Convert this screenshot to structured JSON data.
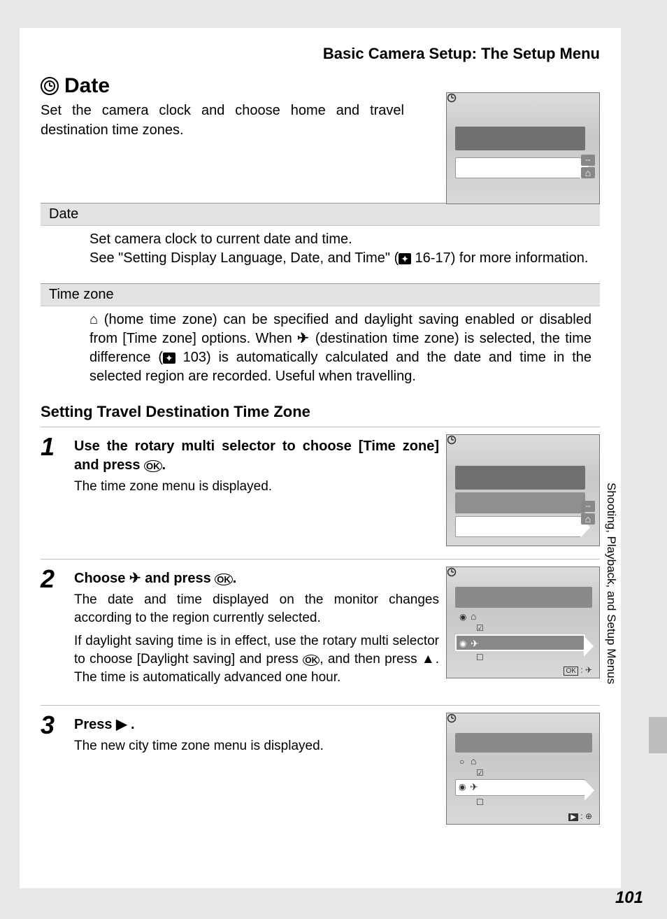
{
  "header": "Basic Camera Setup: The Setup Menu",
  "section": {
    "icon": "clock-icon",
    "title": "Date",
    "intro": "Set the camera clock and choose home and travel destination time zones."
  },
  "table": {
    "r1_label": "Date",
    "r1_body_a": "Set camera clock to current date and time.",
    "r1_body_b": "See \"Setting Display Language, Date, and Time\" (",
    "r1_body_c": " 16-17) for more information.",
    "r2_label": "Time zone",
    "r2_body_a": "(home time zone) can be specified and daylight saving enabled or disabled from [Time zone] options. When ",
    "r2_body_b": " (destination time zone) is selected, the time difference (",
    "r2_body_c": " 103) is automatically calculated and the date and time in the selected region are recorded. Useful when travelling."
  },
  "subsection": "Setting Travel Destination Time Zone",
  "steps": {
    "s1": {
      "num": "1",
      "h_a": "Use the rotary multi selector to choose [Time zone] and press ",
      "h_b": ".",
      "p": "The time zone menu is displayed."
    },
    "s2": {
      "num": "2",
      "h_a": "Choose ",
      "h_b": " and press ",
      "h_c": ".",
      "p1": "The date and time displayed on the monitor changes according to the region currently selected.",
      "p2_a": "If daylight saving time is in effect, use the rotary multi selector to choose [Daylight saving] and press ",
      "p2_b": ", and then press ",
      "p2_c": ". The time is automatically advanced one hour."
    },
    "s3": {
      "num": "3",
      "h_a": "Press ",
      "h_b": " .",
      "p": "The new city time zone menu is displayed."
    }
  },
  "side_label": "Shooting, Playback, and Setup Menus",
  "page_number": "101",
  "glyphs": {
    "clock": "⏲",
    "ok": "ⓚ",
    "home": "⌂",
    "plane": "✈",
    "up": "▲",
    "right": "▶",
    "ref": "☞",
    "dashes": "--",
    "globe": "⊕",
    "radio_on": "◉",
    "radio_off": "○",
    "check_on": "☑",
    "check_off": "☐"
  }
}
